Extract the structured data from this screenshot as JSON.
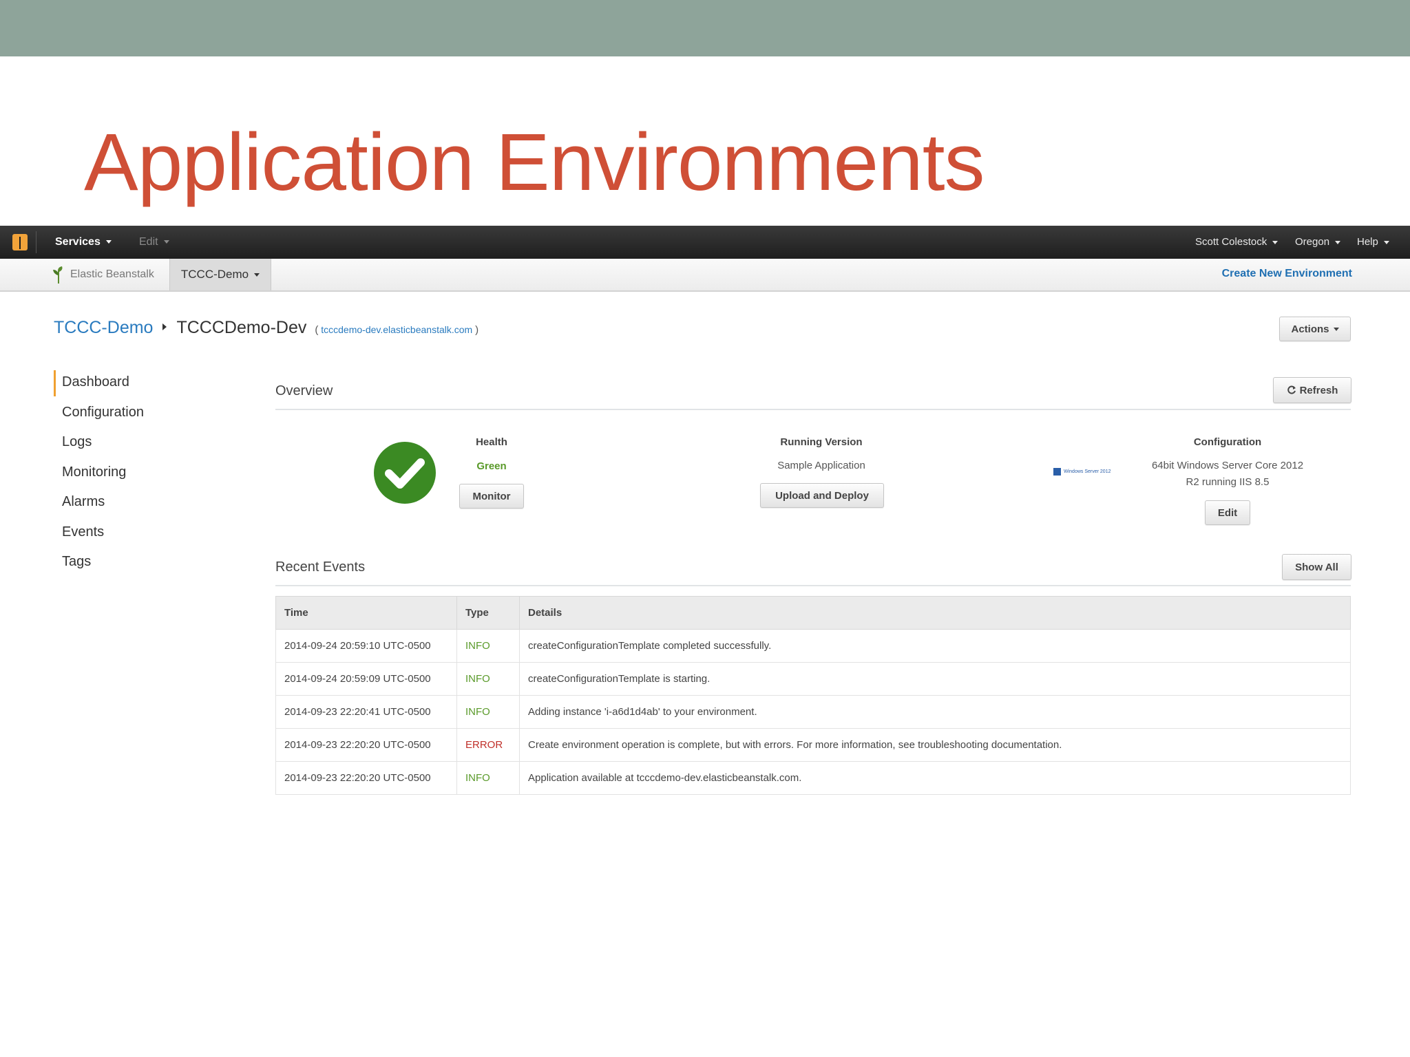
{
  "slide": {
    "title": "Application Environments"
  },
  "topbar": {
    "services": "Services",
    "edit": "Edit",
    "user": "Scott Colestock",
    "region": "Oregon",
    "help": "Help"
  },
  "subbar": {
    "service_name": "Elastic Beanstalk",
    "app_tab": "TCCC-Demo",
    "create_env": "Create New Environment"
  },
  "breadcrumb": {
    "app": "TCCC-Demo",
    "env": "TCCCDemo-Dev",
    "url": "tcccdemo-dev.elasticbeanstalk.com",
    "open_paren": "(",
    "close_paren": ")"
  },
  "actions_label": "Actions",
  "sidebar": {
    "items": [
      {
        "label": "Dashboard"
      },
      {
        "label": "Configuration"
      },
      {
        "label": "Logs"
      },
      {
        "label": "Monitoring"
      },
      {
        "label": "Alarms"
      },
      {
        "label": "Events"
      },
      {
        "label": "Tags"
      }
    ]
  },
  "overview": {
    "title": "Overview",
    "refresh_label": "Refresh",
    "health": {
      "label": "Health",
      "value": "Green",
      "button": "Monitor",
      "status_color": "#3b8a23"
    },
    "running_version": {
      "label": "Running Version",
      "value": "Sample Application",
      "button": "Upload and Deploy"
    },
    "configuration": {
      "label": "Configuration",
      "line1": "64bit Windows Server Core 2012",
      "line2": "R2 running IIS 8.5",
      "badge": "Windows Server 2012",
      "button": "Edit"
    }
  },
  "recent_events": {
    "title": "Recent Events",
    "show_all": "Show All",
    "columns": [
      "Time",
      "Type",
      "Details"
    ],
    "rows": [
      {
        "time": "2014-09-24 20:59:10 UTC-0500",
        "type": "INFO",
        "details": "createConfigurationTemplate completed successfully."
      },
      {
        "time": "2014-09-24 20:59:09 UTC-0500",
        "type": "INFO",
        "details": "createConfigurationTemplate is starting."
      },
      {
        "time": "2014-09-23 22:20:41 UTC-0500",
        "type": "INFO",
        "details": "Adding instance 'i-a6d1d4ab' to your environment."
      },
      {
        "time": "2014-09-23 22:20:20 UTC-0500",
        "type": "ERROR",
        "details": "Create environment operation is complete, but with errors. For more information, see troubleshooting documentation."
      },
      {
        "time": "2014-09-23 22:20:20 UTC-0500",
        "type": "INFO",
        "details": "Application available at tcccdemo-dev.elasticbeanstalk.com."
      }
    ]
  },
  "colors": {
    "title": "#cf4f36",
    "accent_link": "#2a7bbf",
    "info": "#5a9a2a",
    "error": "#c0302a",
    "band": "#8ea49a"
  }
}
